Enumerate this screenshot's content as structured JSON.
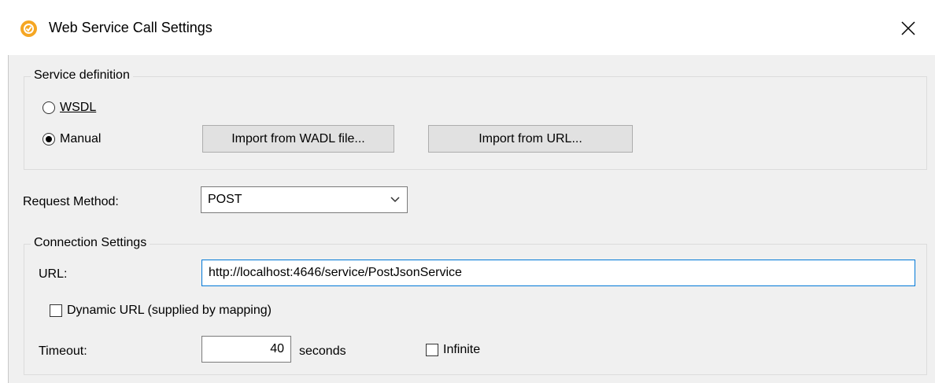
{
  "window": {
    "title": "Web Service Call Settings"
  },
  "service_definition": {
    "legend": "Service definition",
    "wsdl_label": "WSDL",
    "manual_label": "Manual",
    "selected": "Manual",
    "import_wadl_button": "Import from WADL file...",
    "import_url_button": "Import from URL..."
  },
  "request_method": {
    "label": "Request Method:",
    "value": "POST"
  },
  "connection": {
    "legend": "Connection Settings",
    "url_label": "URL:",
    "url_value": "http://localhost:4646/service/PostJsonService",
    "dynamic_url_label": "Dynamic URL (supplied by mapping)",
    "dynamic_url_checked": false,
    "timeout_label": "Timeout:",
    "timeout_value": "40",
    "seconds_label": "seconds",
    "infinite_label": "Infinite",
    "infinite_checked": false
  },
  "colors": {
    "accent": "#0078d7",
    "app_icon": "#f5a623"
  }
}
